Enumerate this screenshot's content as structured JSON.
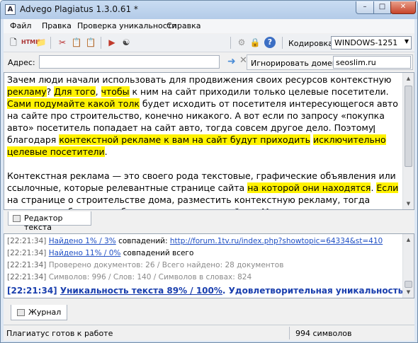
{
  "window": {
    "title": "Advego Plagiatus 1.3.0.61 *",
    "app_icon_letter": "A"
  },
  "menu": [
    "Файл",
    "Правка",
    "Проверка уникальности",
    "Справка"
  ],
  "toolbar": {
    "encoding_label": "Кодировка:",
    "encoding_value": "WINDOWS-1251"
  },
  "address": {
    "label": "Адрес:",
    "value": "",
    "ignore_label": "Игнорировать домены:",
    "ignore_value": "seoslim.ru"
  },
  "editor": {
    "tab_label": "Редактор текста",
    "paragraphs": [
      [
        {
          "t": "Зачем люди начали использовать для продвижения своих ресурсов контекстную ",
          "h": false
        },
        {
          "t": "рекламу",
          "h": true
        },
        {
          "t": "? ",
          "h": false
        },
        {
          "t": "Для того",
          "h": true
        },
        {
          "t": ", ",
          "h": false
        },
        {
          "t": "чтобы",
          "h": true
        },
        {
          "t": " к ним на сайт приходили только целевые посетители. ",
          "h": false
        },
        {
          "t": "Сами подумайте какой толк",
          "h": true
        },
        {
          "t": " будет исходить от посетителя интересующегося авто на сайте про строительство, конечно никакого. А вот если по запросу «покупка авто» посетитель попадает на сайт авто, тогда совсем другое дело. Поэтому благодаря ",
          "h": false
        },
        {
          "t": "контекстной рекламе к вам на сайт будут приходить",
          "h": true
        },
        {
          "t": " ",
          "h": false
        },
        {
          "t": "исключительно целевые посетители",
          "h": true
        },
        {
          "t": ".",
          "h": false
        }
      ],
      [
        {
          "t": "Контекстная реклама — это своего рода текстовые, графические объявления или ссылочные, которые релевантные странице сайта ",
          "h": false
        },
        {
          "t": "на которой они находятся",
          "h": true
        },
        {
          "t": ". ",
          "h": false
        },
        {
          "t": "Если",
          "h": true
        },
        {
          "t": " на странице о строительстве дома, разместить контекстную рекламу, тогда рекламные объявления будут такого типа: стройка в Москве, купить дом, а это уже поможет привлечь на сайт исключительно целевой трафик.",
          "h": false
        }
      ]
    ]
  },
  "log": {
    "lines": [
      {
        "ts": "[22:21:34]",
        "link": "Найдено 1% / 3%",
        "rest": " совпадений: ",
        "url": "http://forum.1tv.ru/index.php?showtopic=64334&st=410",
        "style": "link"
      },
      {
        "ts": "[22:21:34]",
        "link": "Найдено 11% / 0%",
        "rest": " совпадений всего",
        "url": "",
        "style": "link"
      },
      {
        "ts": "[22:21:34]",
        "link": "",
        "rest": "Проверено документов: 26  /  Всего найдено: 28 документов",
        "url": "",
        "style": "gray"
      },
      {
        "ts": "[22:21:34]",
        "link": "",
        "rest": "Символов: 996 / Слов: 140 / Символов в словах: 824",
        "url": "",
        "style": "gray"
      },
      {
        "ts": "[22:21:34]",
        "link": "Уникальность текста 89% / 100%",
        "rest": ". Удовлетворительная уникальность текста.",
        "url": "",
        "style": "final"
      }
    ]
  },
  "journal_tab": "Журнал",
  "status": {
    "left": "Плагиатус готов к работе",
    "right": "994 символов"
  }
}
